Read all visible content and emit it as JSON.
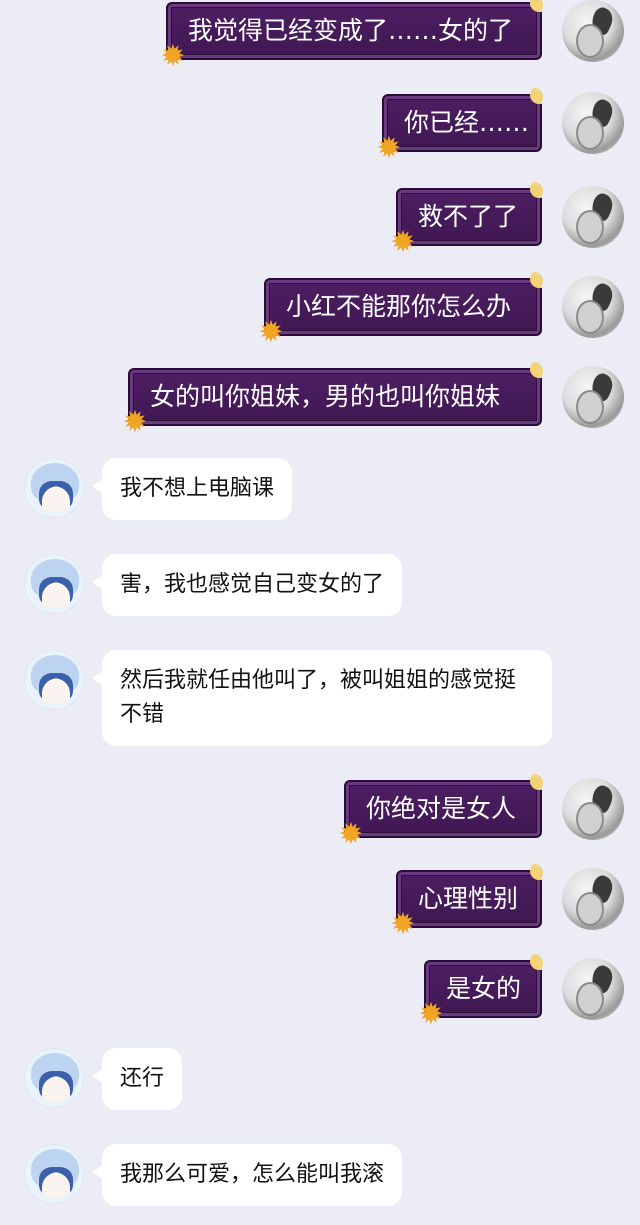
{
  "messages": [
    {
      "side": "out",
      "text": "我觉得已经变成了……女的了"
    },
    {
      "side": "out",
      "text": "你已经……"
    },
    {
      "side": "out",
      "text": "救不了了"
    },
    {
      "side": "out",
      "text": "小红不能那你怎么办"
    },
    {
      "side": "out",
      "text": "女的叫你姐妹，男的也叫你姐妹"
    },
    {
      "side": "in",
      "text": "我不想上电脑课"
    },
    {
      "side": "in",
      "text": "害，我也感觉自己变女的了"
    },
    {
      "side": "in",
      "text": "然后我就任由他叫了，被叫姐姐的感觉挺不错"
    },
    {
      "side": "out",
      "text": "你绝对是女人"
    },
    {
      "side": "out",
      "text": "心理性别"
    },
    {
      "side": "out",
      "text": "是女的"
    },
    {
      "side": "in",
      "text": "还行"
    },
    {
      "side": "in",
      "text": "我那么可爱，怎么能叫我滚"
    }
  ],
  "icons": {
    "sun": "sun-sticker-icon",
    "moon": "moon-sticker-icon"
  },
  "colors": {
    "background": "#ececf6",
    "out_bubble": "#4e1f63",
    "in_bubble": "#ffffff"
  }
}
